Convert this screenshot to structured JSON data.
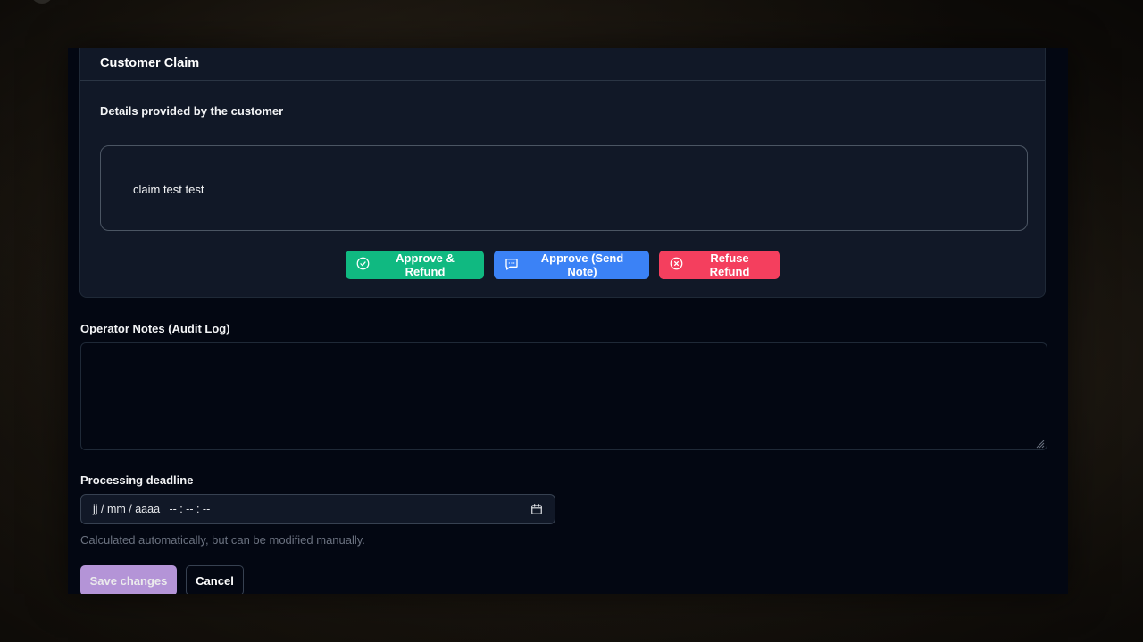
{
  "claim": {
    "title": "Customer Claim",
    "details_label": "Details provided by the customer",
    "text": "claim test test"
  },
  "actions": {
    "approve_refund": {
      "label": "Approve & Refund",
      "icon": "check-circle-icon",
      "color": "#10b981"
    },
    "approve_note": {
      "label": "Approve (Send Note)",
      "icon": "message-square-icon",
      "color": "#3b82f6"
    },
    "refuse_refund": {
      "label": "Refuse Refund",
      "icon": "x-circle-icon",
      "color": "#f43f5e"
    }
  },
  "notes": {
    "label": "Operator Notes (Audit Log)",
    "value": ""
  },
  "deadline": {
    "label": "Processing deadline",
    "value": "jj / mm / aaaa   -- : -- : --",
    "icon": "calendar-icon",
    "help": "Calculated automatically, but can be modified manually."
  },
  "footer": {
    "save_label": "Save changes",
    "cancel_label": "Cancel",
    "save_color": "#c4a1e8"
  }
}
